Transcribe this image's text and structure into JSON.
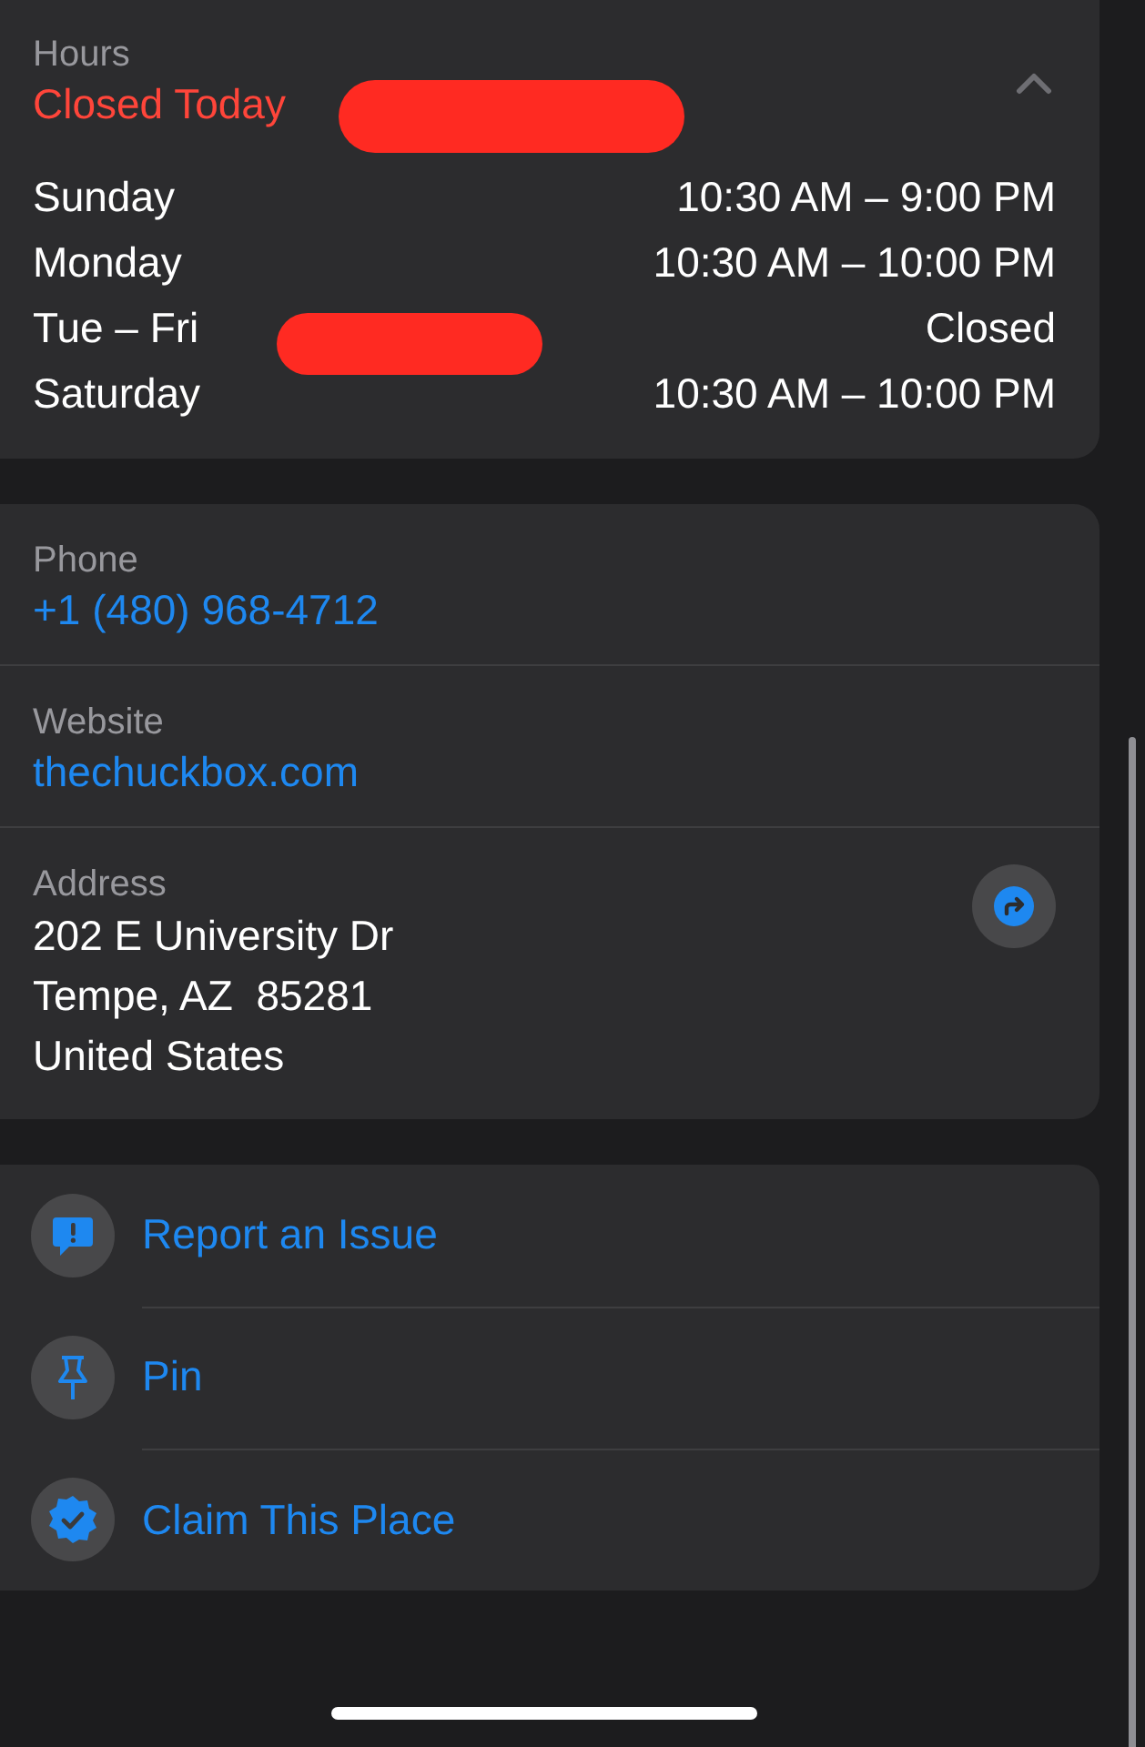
{
  "hours": {
    "label": "Hours",
    "status": "Closed Today",
    "expanded": true,
    "days": [
      {
        "day": "Sunday",
        "time": "10:30 AM – 9:00 PM"
      },
      {
        "day": "Monday",
        "time": "10:30 AM – 10:00 PM"
      },
      {
        "day": "Tue – Fri",
        "time": "Closed"
      },
      {
        "day": "Saturday",
        "time": "10:30 AM – 10:00 PM"
      }
    ]
  },
  "contact": [
    {
      "kind": "link",
      "label": "Phone",
      "value": "+1 (480) 968-4712"
    },
    {
      "kind": "link",
      "label": "Website",
      "value": "thechuckbox.com"
    },
    {
      "kind": "address",
      "label": "Address",
      "lines": [
        "202 E University Dr",
        "Tempe, AZ  85281",
        "United States"
      ]
    }
  ],
  "actions": [
    {
      "kind": "report",
      "label": "Report an Issue"
    },
    {
      "kind": "pin",
      "label": "Pin"
    },
    {
      "kind": "claim",
      "label": "Claim This Place"
    }
  ]
}
